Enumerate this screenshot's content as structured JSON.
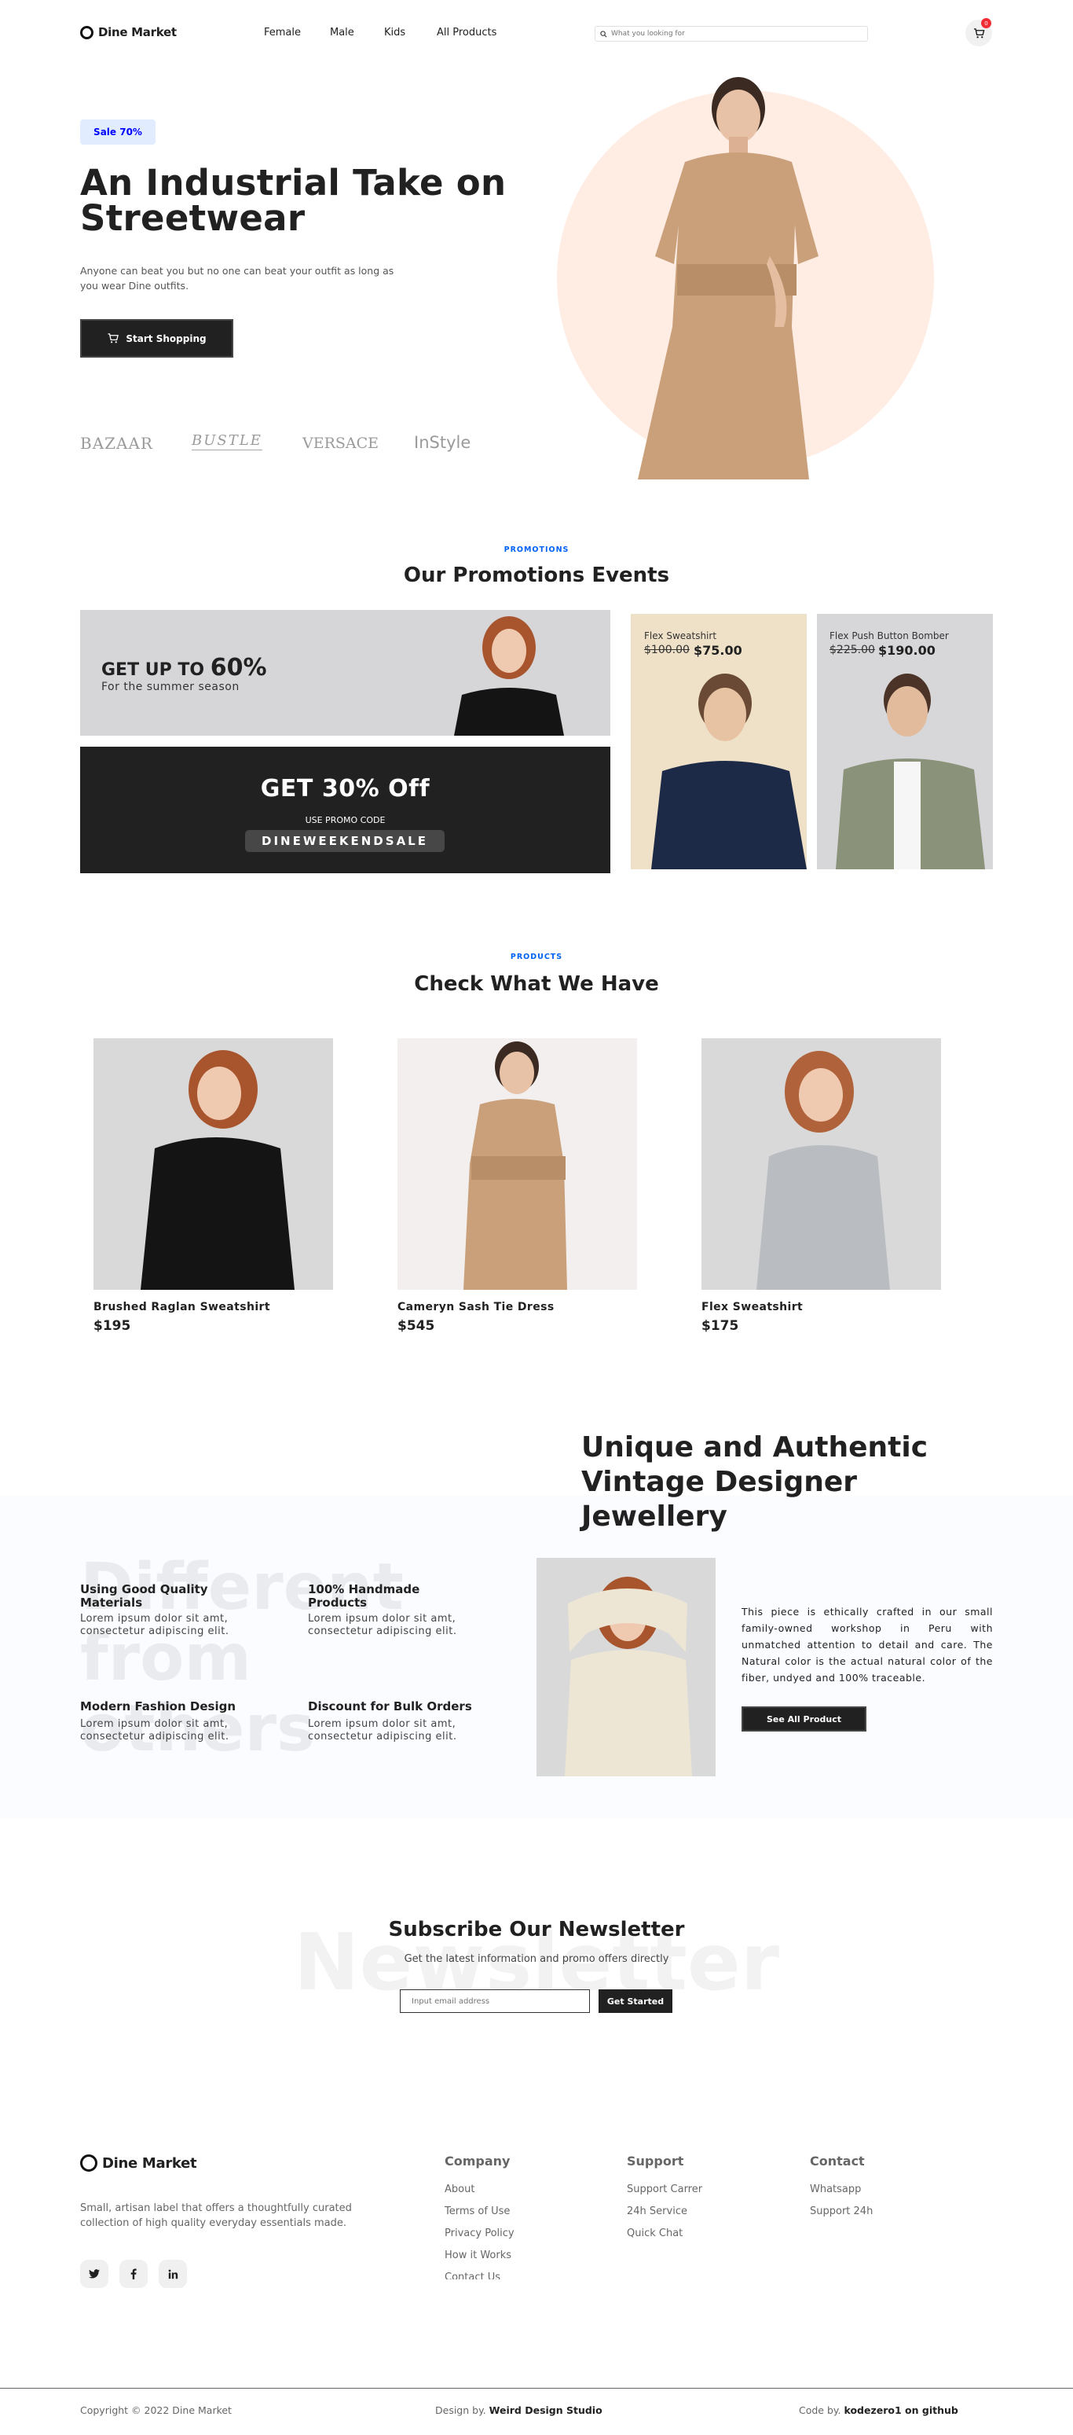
{
  "header": {
    "logo_text": "Dine Market",
    "nav": [
      "Female",
      "Male",
      "Kids",
      "All Products"
    ],
    "search_placeholder": "What you looking for",
    "cart_count": "0"
  },
  "hero": {
    "tag": "Sale 70%",
    "title": "An Industrial Take on Streetwear",
    "description": "Anyone can beat you but no one can beat your outfit as long as you wear Dine outfits.",
    "cta": "Start Shopping",
    "brands": [
      "BAZAAR",
      "BUSTLE",
      "VERSACE",
      "InStyle"
    ],
    "accent_circle_color": "#ffece3"
  },
  "promotions": {
    "tag": "PROMOTIONS",
    "title": "Our Promotions Events",
    "card1": {
      "prefix": "GET UP TO",
      "big": "60%",
      "sub": "For the summer season"
    },
    "card2": {
      "title": "GET 30% Off",
      "label": "USE PROMO CODE",
      "code": "DINEWEEKENDSALE"
    },
    "card3": {
      "name": "Flex Sweatshirt",
      "old_price": "$100.00",
      "price": "$75.00",
      "bg": "#efe1c7"
    },
    "card4": {
      "name": "Flex Push Button Bomber",
      "old_price": "$225.00",
      "price": "$190.00",
      "bg": "#d7d7d9"
    }
  },
  "products": {
    "tag": "PRODUCTS",
    "title": "Check What We Have",
    "items": [
      {
        "name": "Brushed Raglan Sweatshirt",
        "price": "$195"
      },
      {
        "name": "Cameryn Sash Tie Dress",
        "price": "$545"
      },
      {
        "name": "Flex Sweatshirt",
        "price": "$175"
      }
    ]
  },
  "jewellery": {
    "title": "Unique and Authentic Vintage Designer Jewellery",
    "watermark": [
      "Different",
      "from",
      "others"
    ],
    "features": [
      {
        "title": "Using Good Quality Materials",
        "text": "Lorem ipsum dolor sit amt, consectetur adipiscing elit."
      },
      {
        "title": "100% Handmade Products",
        "text": "Lorem ipsum dolor sit amt, consectetur adipiscing elit."
      },
      {
        "title": "Modern Fashion Design",
        "text": "Lorem ipsum dolor sit amt, consectetur adipiscing elit."
      },
      {
        "title": "Discount for Bulk Orders",
        "text": "Lorem ipsum dolor sit amt, consectetur adipiscing elit."
      }
    ],
    "description": "This piece is ethically crafted in our small family-owned workshop in Peru with unmatched attention to detail and care. The Natural color is the actual natural color of the fiber, undyed and 100% traceable.",
    "cta": "See All Product"
  },
  "newsletter": {
    "watermark": "Newsletter",
    "title": "Subscribe Our Newsletter",
    "subtitle": "Get the latest information and promo offers directly",
    "placeholder": "Input email address",
    "cta": "Get Started"
  },
  "footer": {
    "logo_text": "Dine Market",
    "about": "Small, artisan label that offers a thoughtfully curated collection of high quality everyday essentials made.",
    "social": [
      "twitter-icon",
      "facebook-icon",
      "linkedin-icon"
    ],
    "columns": [
      {
        "title": "Company",
        "links": [
          "About",
          "Terms of Use",
          "Privacy Policy",
          "How it Works",
          "Contact Us"
        ]
      },
      {
        "title": "Support",
        "links": [
          "Support Carrer",
          "24h Service",
          "Quick Chat"
        ]
      },
      {
        "title": "Contact",
        "links": [
          "Whatsapp",
          "Support 24h"
        ]
      }
    ]
  },
  "bottom_bar": {
    "copyright": "Copyright © 2022 Dine Market",
    "design_label": "Design by.",
    "design_name": "Weird Design Studio",
    "code_label": "Code by.",
    "code_name": "kodezero1 on github"
  }
}
